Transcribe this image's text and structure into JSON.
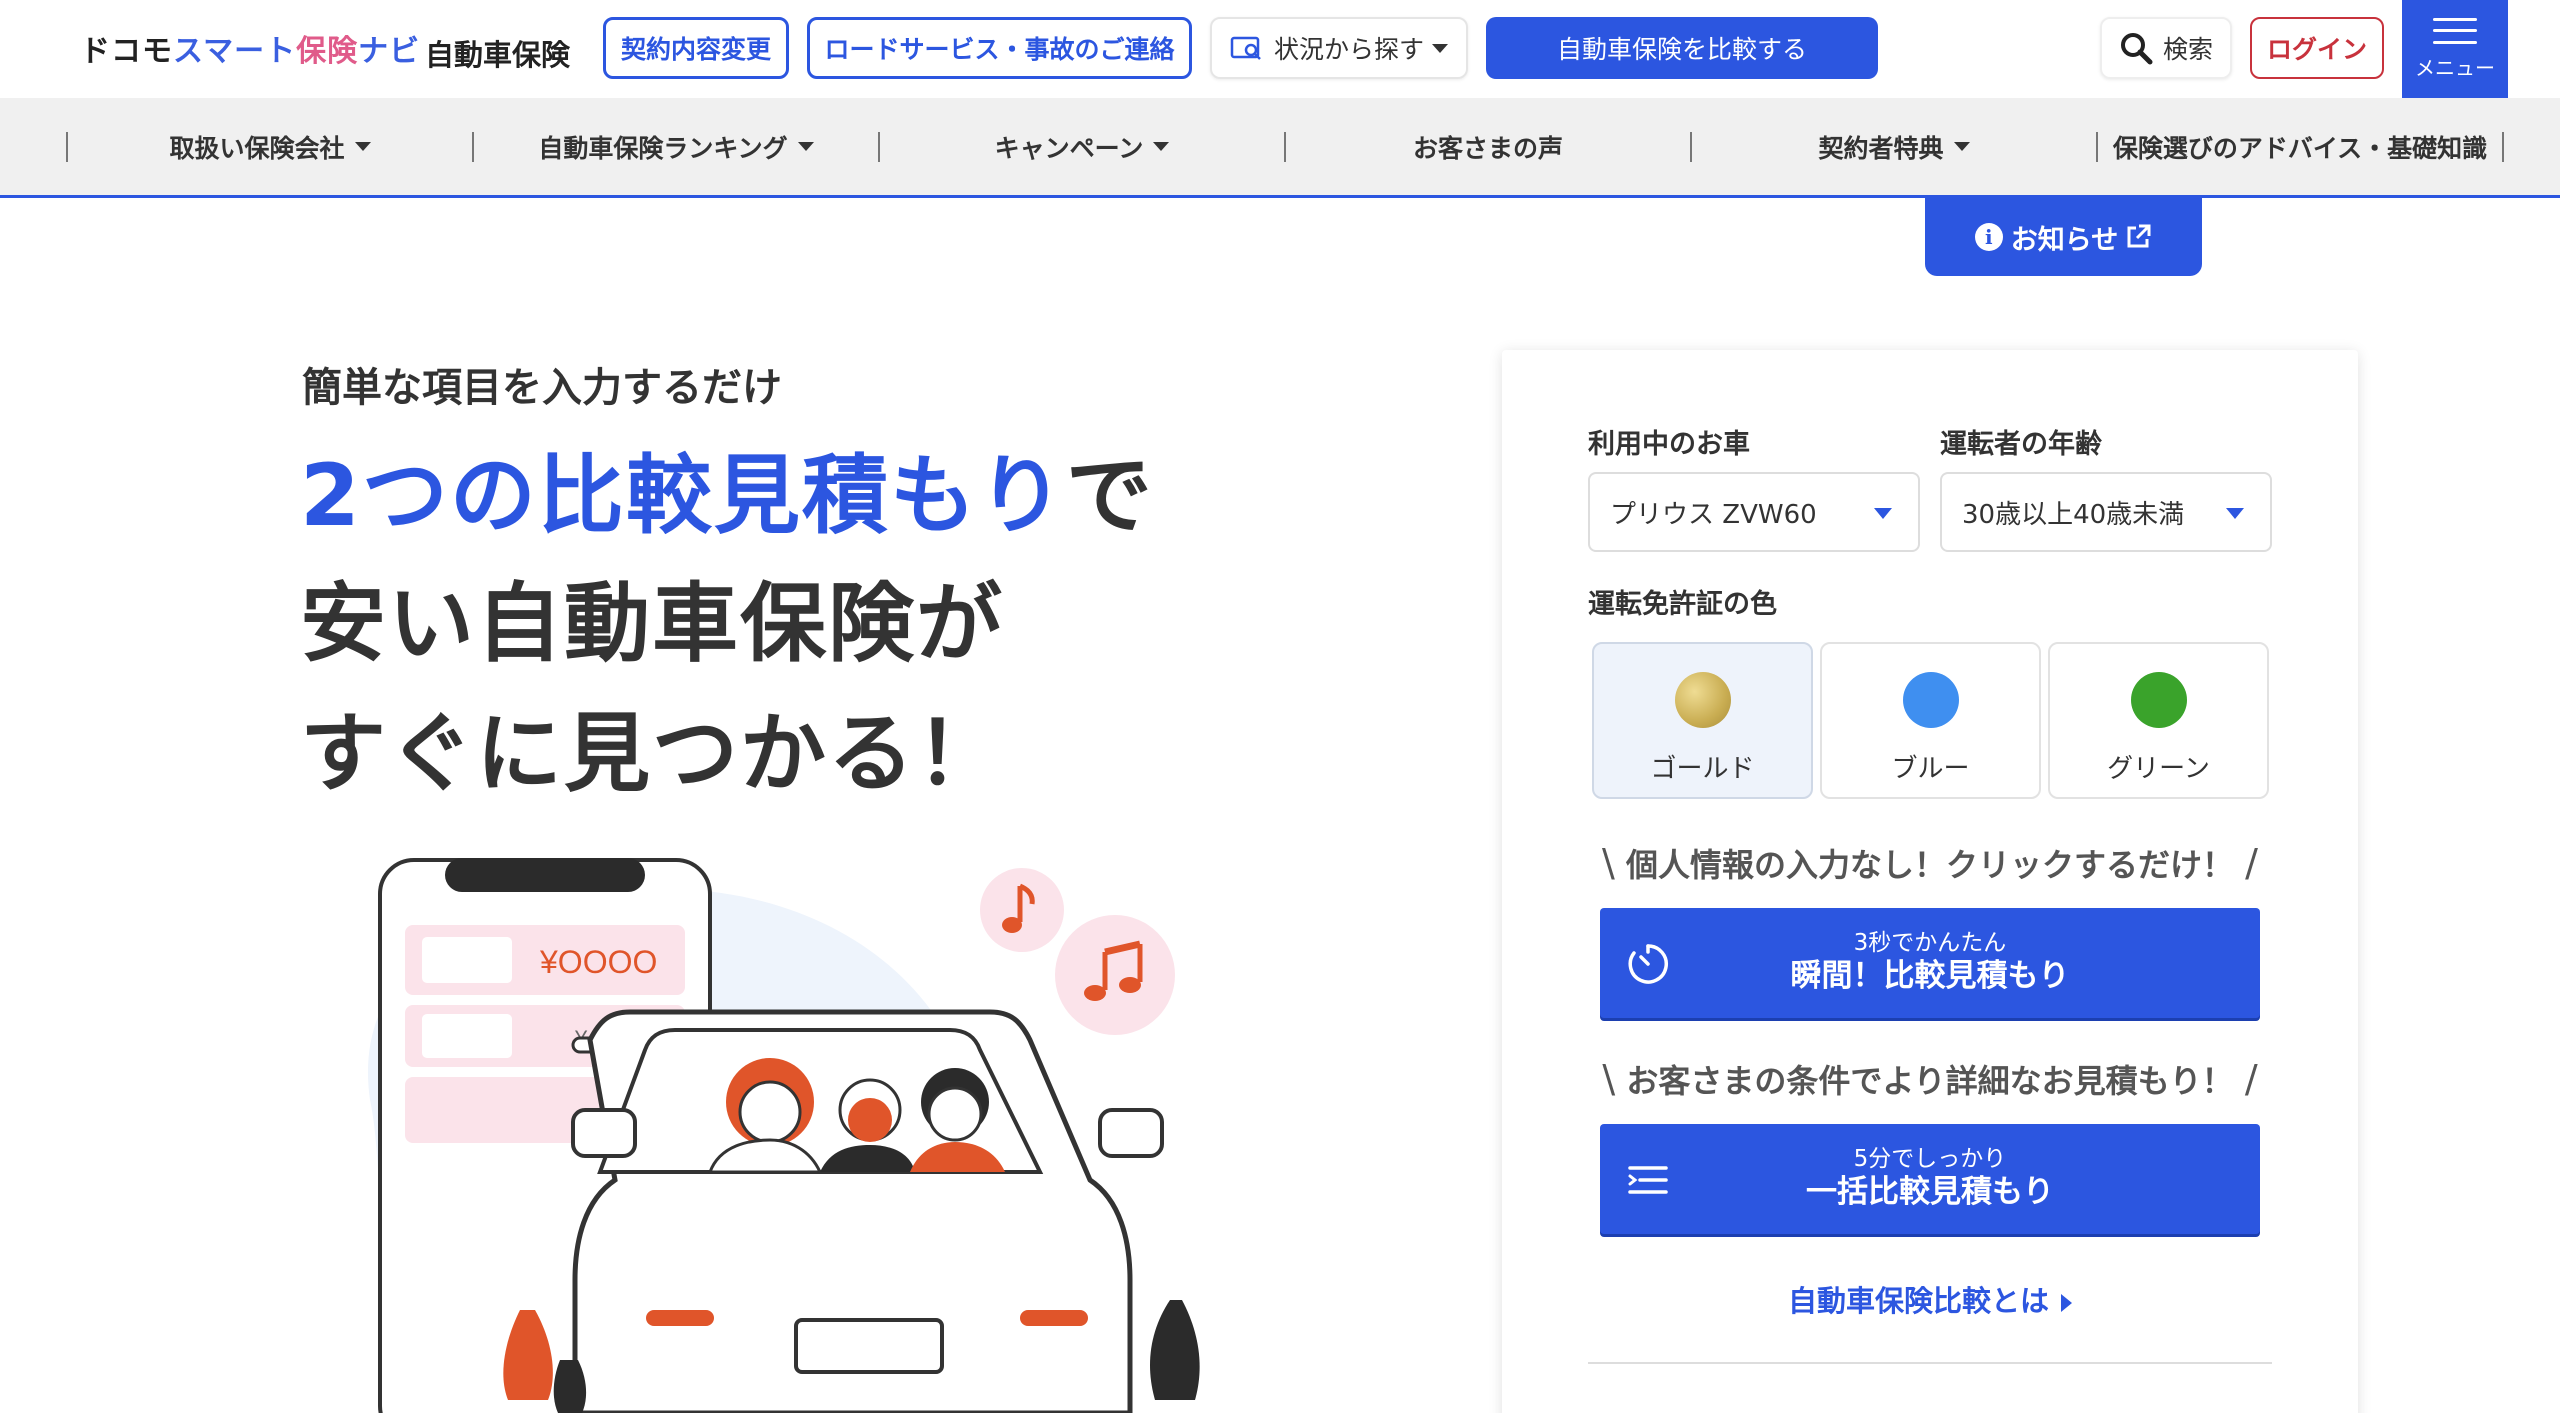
{
  "header": {
    "logo": {
      "part1": "ドコモ",
      "part2": "スマート",
      "part3": "保険",
      "part4": "ナビ"
    },
    "section_label": "自動車保険",
    "contract_change": "契約内容変更",
    "road_service": "ロードサービス・事故のご連絡",
    "search_situation": "状況から探す",
    "compare_cta": "自動車保険を比較する",
    "search": "検索",
    "login": "ログイン",
    "menu": "メニュー"
  },
  "nav": {
    "items": [
      {
        "label": "取扱い保険会社",
        "dropdown": true
      },
      {
        "label": "自動車保険ランキング",
        "dropdown": true
      },
      {
        "label": "キャンペーン",
        "dropdown": true
      },
      {
        "label": "お客さまの声",
        "dropdown": false
      },
      {
        "label": "契約者特典",
        "dropdown": true
      },
      {
        "label": "保険選びのアドバイス・基礎知識",
        "dropdown": false
      }
    ]
  },
  "notice": {
    "label": "お知らせ"
  },
  "hero": {
    "eyebrow": "簡単な項目を入力するだけ",
    "headline_accent": "2つの比較見積もり",
    "headline_rest": "で",
    "line2": "安い自動車保険が",
    "line3": "すぐに見つかる！"
  },
  "illustration": {
    "price_main": "¥OOOO",
    "price_sub": "¥△△△△"
  },
  "form": {
    "car_label": "利用中のお車",
    "car_value": "プリウス ZVW60",
    "age_label": "運転者の年齢",
    "age_value": "30歳以上40歳未満",
    "license_label": "運転免許証の色",
    "license_colors": [
      {
        "name": "ゴールド",
        "color": "#c9ad52",
        "selected": true
      },
      {
        "name": "ブルー",
        "color": "#3f8ff0",
        "selected": false
      },
      {
        "name": "グリーン",
        "color": "#3aa32b",
        "selected": false
      }
    ],
    "tagline1": "個人情報の入力なし！クリックするだけ！",
    "cta1_sub": "3秒でかんたん",
    "cta1_main": "瞬間！比較見積もり",
    "tagline2": "お客さまの条件でより詳細なお見積もり！",
    "cta2_sub": "5分でしっかり",
    "cta2_main": "一括比較見積もり",
    "about_link": "自動車保険比較とは"
  },
  "colors": {
    "primary": "#2c56e0",
    "login_red": "#c8323c",
    "illustration_orange": "#e0552a",
    "illustration_pink": "#fbe3ea"
  }
}
